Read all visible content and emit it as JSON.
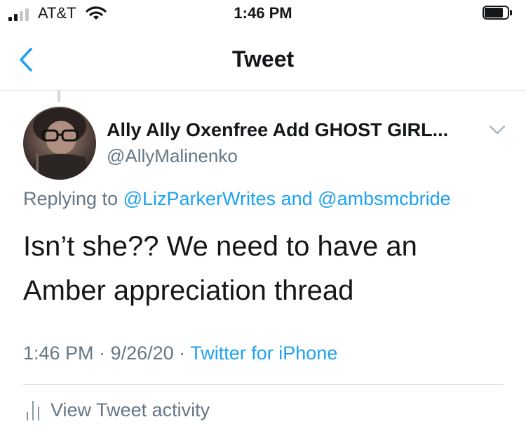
{
  "status_bar": {
    "carrier": "AT&T",
    "time": "1:46 PM",
    "signal_bars_filled": 2,
    "signal_bars_total": 4
  },
  "nav": {
    "title": "Tweet",
    "back_icon": "chevron-left-icon"
  },
  "tweet": {
    "display_name": "Ally Ally Oxenfree Add GHOST GIRL...",
    "handle": "@AllyMalinenko",
    "replying_prefix": "Replying to",
    "reply_to_1": "@LizParkerWrites",
    "reply_and": "and",
    "reply_to_2": "@ambsmcbride",
    "text_line_1": "Isn’t she?? We need to have an",
    "text_line_2": "Amber appreciation thread",
    "time": "1:46 PM",
    "date": "9/26/20",
    "separator": "·",
    "source": "Twitter for iPhone"
  },
  "activity": {
    "label": "View Tweet activity",
    "icon": "bar-chart-icon"
  },
  "colors": {
    "accent": "#1da1f2",
    "secondary_text": "#657786",
    "divider": "#d6d9dc"
  }
}
